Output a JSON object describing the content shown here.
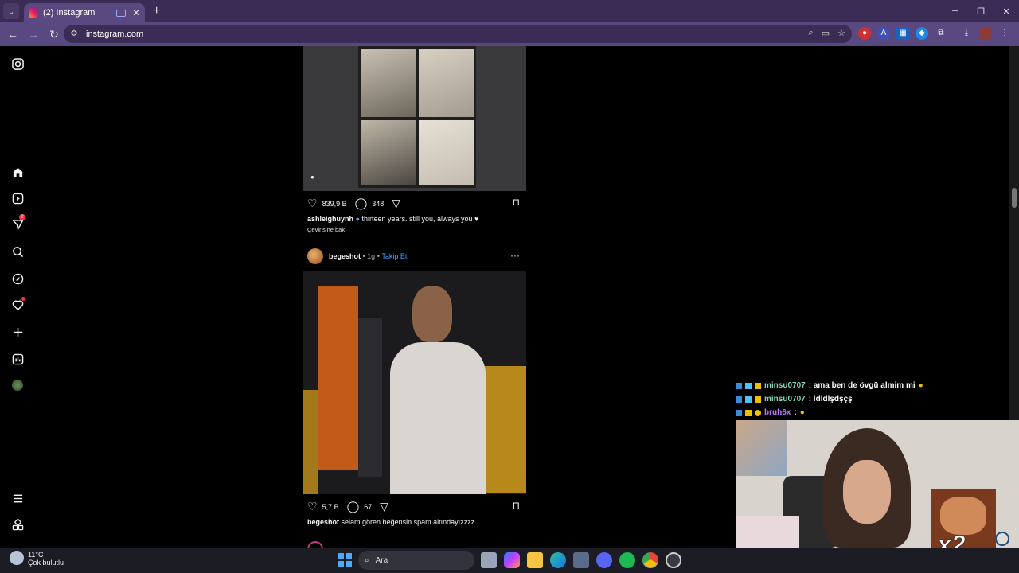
{
  "browser": {
    "tab_title": "(2) Instagram",
    "url": "instagram.com"
  },
  "posts": [
    {
      "likes": "839,9 B",
      "comments": "348",
      "username": "ashleighuynh",
      "caption": "thirteen years. still you, always you",
      "see_translation": "Çevirisine bak"
    },
    {
      "username": "begeshot",
      "time": "1g",
      "follow": "Takip Et",
      "likes": "5,7 B",
      "comments": "67",
      "caption": "selam gören beğensin spam altındayızzzz"
    }
  ],
  "chat": [
    {
      "user": "minsu0707",
      "text": ": ama ben de övgü almim mi",
      "color": "#7fd6b3"
    },
    {
      "user": "minsu0707",
      "text": ": ldldlşdşçş",
      "color": "#7fd6b3"
    },
    {
      "user": "bruh6x",
      "text": ":",
      "color": "#b77bff"
    }
  ],
  "overlay": {
    "multiplier": "x2"
  },
  "taskbar": {
    "temp": "11°C",
    "weather": "Çok bulutlu",
    "search": "Ara"
  }
}
